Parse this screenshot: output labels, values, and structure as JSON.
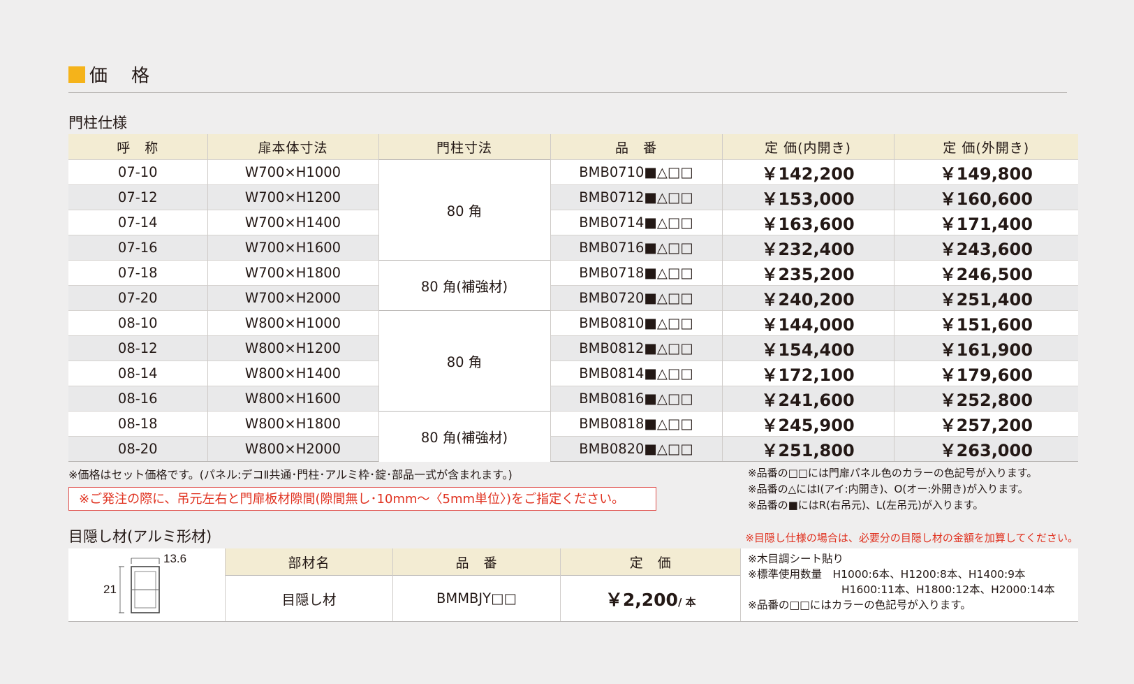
{
  "section_title": "価　格",
  "post_spec_title": "門柱仕様",
  "headers": [
    "呼　称",
    "扉本体寸法",
    "門柱寸法",
    "品　番",
    "定 価(内開き)",
    "定 価(外開き)"
  ],
  "rows": [
    {
      "name": "07-10",
      "size": "W700×H1000",
      "code": "BMB0710■△□□",
      "in": "￥142,200",
      "out": "￥149,800"
    },
    {
      "name": "07-12",
      "size": "W700×H1200",
      "code": "BMB0712■△□□",
      "in": "￥153,000",
      "out": "￥160,600"
    },
    {
      "name": "07-14",
      "size": "W700×H1400",
      "code": "BMB0714■△□□",
      "in": "￥163,600",
      "out": "￥171,400"
    },
    {
      "name": "07-16",
      "size": "W700×H1600",
      "code": "BMB0716■△□□",
      "in": "￥232,400",
      "out": "￥243,600"
    },
    {
      "name": "07-18",
      "size": "W700×H1800",
      "code": "BMB0718■△□□",
      "in": "￥235,200",
      "out": "￥246,500"
    },
    {
      "name": "07-20",
      "size": "W700×H2000",
      "code": "BMB0720■△□□",
      "in": "￥240,200",
      "out": "￥251,400"
    },
    {
      "name": "08-10",
      "size": "W800×H1000",
      "code": "BMB0810■△□□",
      "in": "￥144,000",
      "out": "￥151,600"
    },
    {
      "name": "08-12",
      "size": "W800×H1200",
      "code": "BMB0812■△□□",
      "in": "￥154,400",
      "out": "￥161,900"
    },
    {
      "name": "08-14",
      "size": "W800×H1400",
      "code": "BMB0814■△□□",
      "in": "￥172,100",
      "out": "￥179,600"
    },
    {
      "name": "08-16",
      "size": "W800×H1600",
      "code": "BMB0816■△□□",
      "in": "￥241,600",
      "out": "￥252,800"
    },
    {
      "name": "08-18",
      "size": "W800×H1800",
      "code": "BMB0818■△□□",
      "in": "￥245,900",
      "out": "￥257,200"
    },
    {
      "name": "08-20",
      "size": "W800×H2000",
      "code": "BMB0820■△□□",
      "in": "￥251,800",
      "out": "￥263,000"
    }
  ],
  "post_groups": [
    "80 角",
    "80 角(補強材)",
    "80 角",
    "80 角(補強材)"
  ],
  "note_left": "※価格はセット価格です。(パネル:デコⅡ共通･門柱･アルミ枠･錠･部品一式が含まれます。)",
  "red_notice": "※ご発注の際に、吊元左右と門扉板材隙間(隙間無し･10mm〜〈5mm単位〉)をご指定ください。",
  "notes_right": [
    "※品番の□□には門扉パネル色のカラーの色記号が入ります。",
    "※品番の△にはI(アイ:内開き)、O(オー:外開き)が入ります。",
    "※品番の■にはR(右吊元)、L(左吊元)が入ります。"
  ],
  "screen_title": "目隠し材(アルミ形材)",
  "screen_red_note": "※目隠し仕様の場合は、必要分の目隠し材の金額を加算してください。",
  "screen_headers": [
    "部材名",
    "品　番",
    "定　価"
  ],
  "screen_row": {
    "name": "目隠し材",
    "code": "BMMBJY□□",
    "price": "￥2,200",
    "unit": "/ 本"
  },
  "profile_dims": {
    "width": "13.6",
    "height": "21"
  },
  "screen_notes": [
    "※木目調シート貼り",
    "※標準使用数量　H1000:6本、H1200:8本、H1400:9本",
    "H1600:11本、H1800:12本、H2000:14本",
    "※品番の□□にはカラーの色記号が入ります。"
  ]
}
